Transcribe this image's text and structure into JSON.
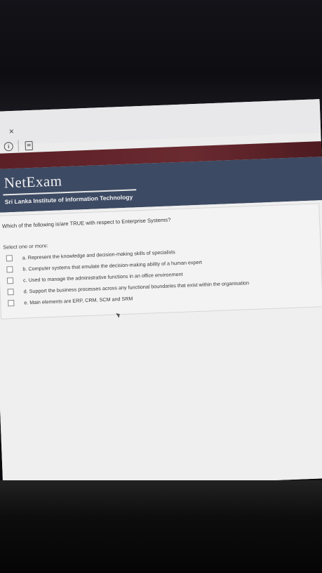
{
  "browser": {
    "close_glyph": "×",
    "icons": [
      "info-icon",
      "page-icon"
    ]
  },
  "header": {
    "logo": "NetExam",
    "subtitle": "Sri Lanka Institute of Information Technology"
  },
  "quiz": {
    "question": "Which of the following is/are TRUE with respect to Enterprise Systems?",
    "instruction": "Select one or more:",
    "options": [
      {
        "label": "a. Represent the knowledge and decision-making skills of specialists",
        "checked": false
      },
      {
        "label": "b. Computer systems that emulate the decision-making ability of a human expert",
        "checked": false
      },
      {
        "label": "c. Used to manage the administrative functions in an office environment",
        "checked": false
      },
      {
        "label": "d. Support the business processes across any functional boundaries that exist within the organisation",
        "checked": false
      },
      {
        "label": "e. Main elements are ERP, CRM, SCM and SRM",
        "checked": false
      }
    ]
  },
  "colors": {
    "header_bg": "#3d4a63",
    "red_band": "#5a1f25",
    "page_bg": "#efefef"
  }
}
